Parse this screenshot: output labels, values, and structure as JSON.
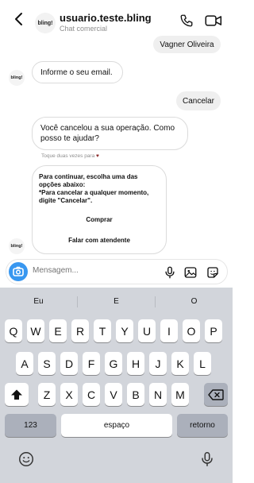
{
  "header": {
    "avatar_text": "bling!",
    "username": "usuario.teste.bling",
    "subtitle": "Chat comercial"
  },
  "chat": {
    "msg_vagner": "Vagner Oliveira",
    "avatar_text": "bling!",
    "msg_email": "Informe o seu email.",
    "msg_cancel": "Cancelar",
    "msg_cancelled": "Você cancelou a sua operação. Como posso te ajudar?",
    "hint": "Toque duas vezes para",
    "options_text_1": "Para continuar, escolha uma das opções abaixo:",
    "options_text_2": "*Para cancelar a qualquer momento, digite \"Cancelar\".",
    "option_buy": "Comprar",
    "option_agent": "Falar com atendente"
  },
  "composer": {
    "placeholder": "Mensagem..."
  },
  "keyboard": {
    "suggestions": [
      "Eu",
      "E",
      "O"
    ],
    "row1": [
      "Q",
      "W",
      "E",
      "R",
      "T",
      "Y",
      "U",
      "I",
      "O",
      "P"
    ],
    "row2": [
      "A",
      "S",
      "D",
      "F",
      "G",
      "H",
      "J",
      "K",
      "L"
    ],
    "row3": [
      "Z",
      "X",
      "C",
      "V",
      "B",
      "N",
      "M"
    ],
    "numbers_label": "123",
    "space_label": "espaço",
    "return_label": "retorno"
  }
}
